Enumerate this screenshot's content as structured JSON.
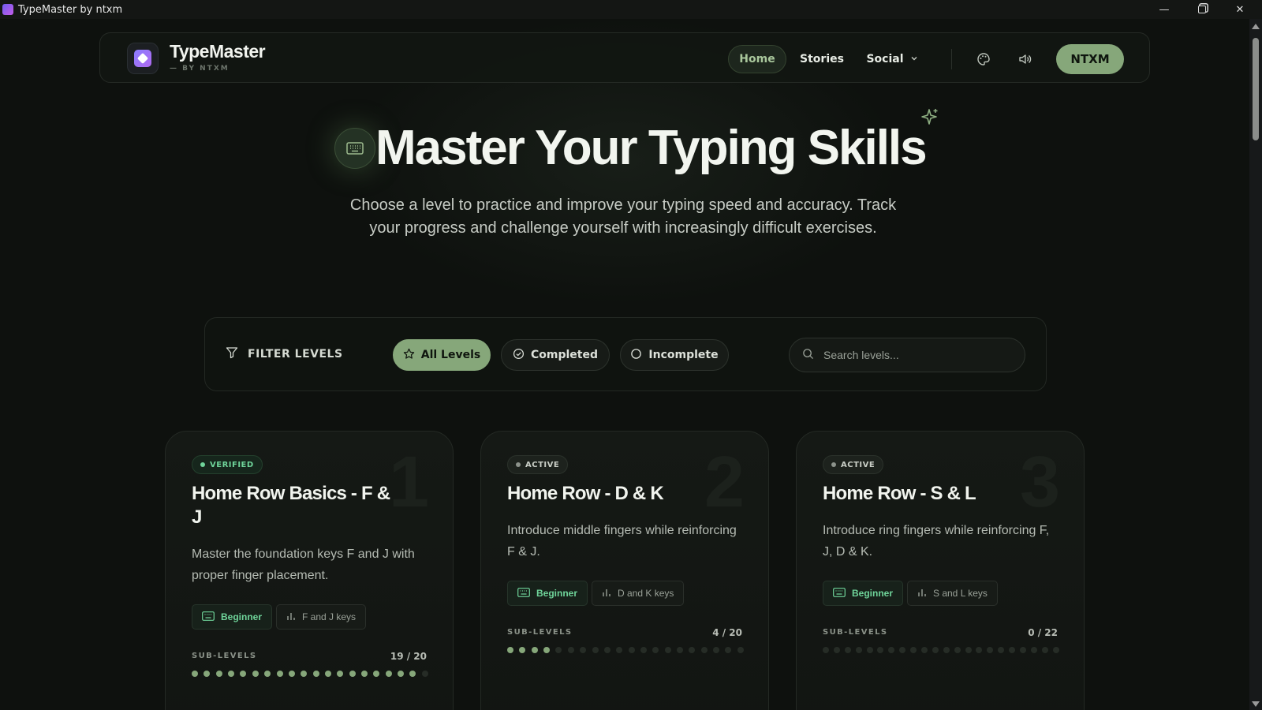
{
  "window": {
    "title": "TypeMaster by ntxm"
  },
  "navbar": {
    "brand_name": "TypeMaster",
    "brand_sub": "— BY NTXM",
    "links": [
      "Home",
      "Stories",
      "Social"
    ],
    "active_link": "Home",
    "user_label": "NTXM"
  },
  "hero": {
    "title": "Master Your Typing Skills",
    "subtitle": "Choose a level to practice and improve your typing speed and accuracy. Track your progress and challenge yourself with increasingly difficult exercises."
  },
  "filter": {
    "label": "FILTER LEVELS",
    "chips": [
      "All Levels",
      "Completed",
      "Incomplete"
    ],
    "selected": "All Levels",
    "search_placeholder": "Search levels...",
    "search_value": ""
  },
  "cards": [
    {
      "number": "1",
      "status": "VERIFIED",
      "title": "Home Row Basics - F & J",
      "description": "Master the foundation keys F and J with proper finger placement.",
      "level": "Beginner",
      "keys": "F and J keys",
      "sub_label": "SUB-LEVELS",
      "sub_count": "19 / 20",
      "completed": 19,
      "total": 20
    },
    {
      "number": "2",
      "status": "ACTIVE",
      "title": "Home Row - D & K",
      "description": "Introduce middle fingers while reinforcing F & J.",
      "level": "Beginner",
      "keys": "D and K keys",
      "sub_label": "SUB-LEVELS",
      "sub_count": "4 / 20",
      "completed": 4,
      "total": 20
    },
    {
      "number": "3",
      "status": "ACTIVE",
      "title": "Home Row - S & L",
      "description": "Introduce ring fingers while reinforcing F, J, D & K.",
      "level": "Beginner",
      "keys": "S and L keys",
      "sub_label": "SUB-LEVELS",
      "sub_count": "0 / 22",
      "completed": 0,
      "total": 22
    }
  ],
  "colors": {
    "accent": "#86a77a",
    "verified": "#6fd49a",
    "background": "#0e110e"
  }
}
